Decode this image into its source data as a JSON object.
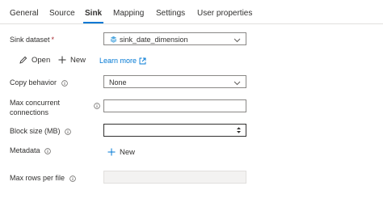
{
  "tabs": [
    {
      "label": "General"
    },
    {
      "label": "Source"
    },
    {
      "label": "Sink",
      "active": true
    },
    {
      "label": "Mapping"
    },
    {
      "label": "Settings"
    },
    {
      "label": "User properties"
    }
  ],
  "sink_dataset": {
    "label": "Sink dataset",
    "required_mark": "*",
    "value": "sink_date_dimension",
    "icon": "dataset-icon"
  },
  "actions": {
    "open_label": "Open",
    "new_label": "New",
    "learn_more_label": "Learn more"
  },
  "copy_behavior": {
    "label": "Copy behavior",
    "value": "None"
  },
  "max_concurrent": {
    "label_line1": "Max concurrent",
    "label_line2": "connections",
    "value": ""
  },
  "block_size": {
    "label": "Block size (MB)",
    "value": ""
  },
  "metadata": {
    "label": "Metadata",
    "new_label": "New"
  },
  "max_rows": {
    "label": "Max rows per file",
    "value": ""
  },
  "colors": {
    "accent": "#0078d4",
    "text": "#323130",
    "required": "#a4262c"
  }
}
